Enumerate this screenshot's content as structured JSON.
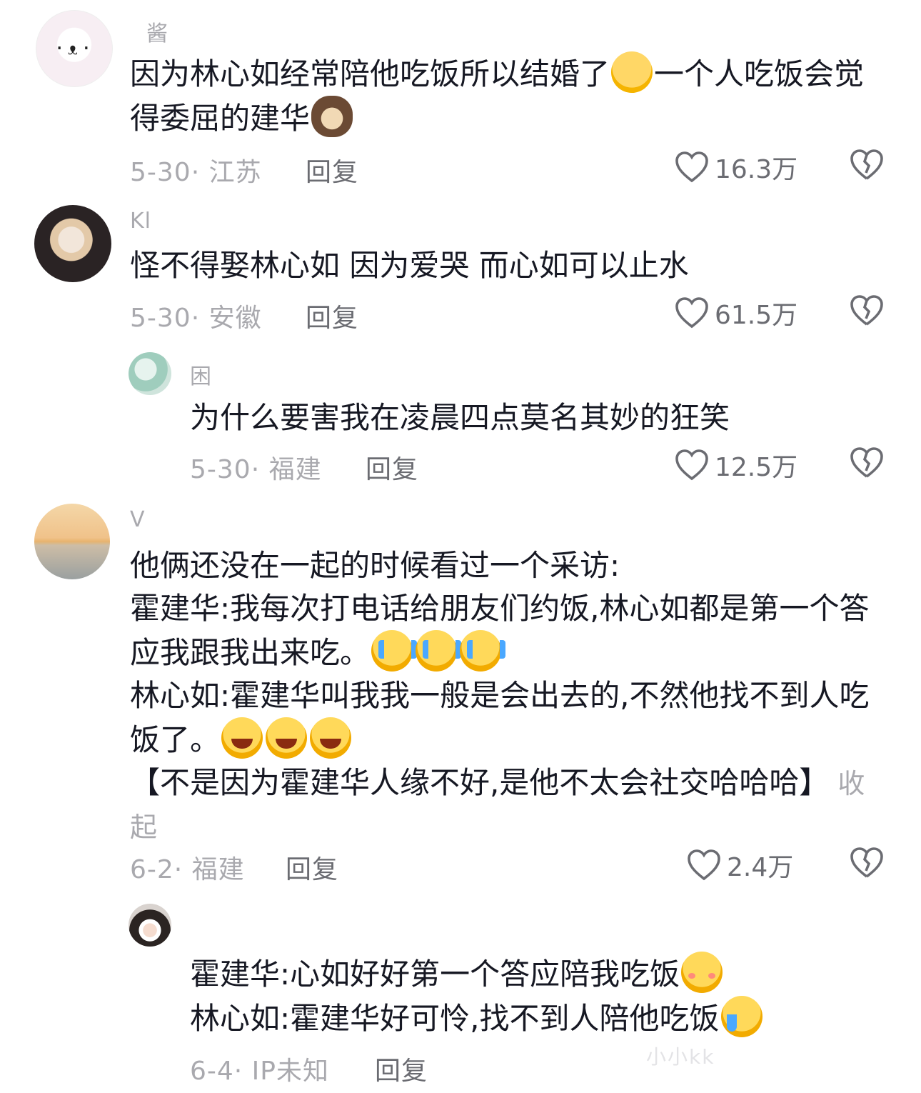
{
  "comments": [
    {
      "username": "酱",
      "text_before": "因为林心如经常陪他吃饭所以结婚了",
      "emoji_1": "pleading-face-emoji",
      "text_mid": "一个人吃饭会觉得委屈的建华",
      "emoji_2": "dog-face-emoji",
      "date_location": "5-30· 江苏",
      "reply_label": "回复",
      "likes": "16.3万"
    },
    {
      "username": "Kl",
      "text": "怪不得娶林心如 因为爱哭 而心如可以止水",
      "date_location": "5-30· 安徽",
      "reply_label": "回复",
      "likes": "61.5万"
    },
    {
      "username": "困",
      "text": "为什么要害我在凌晨四点莫名其妙的狂笑",
      "date_location": "5-30· 福建",
      "reply_label": "回复",
      "likes": "12.5万"
    },
    {
      "username": "V",
      "line1": "他俩还没在一起的时候看过一个采访:",
      "line2": "霍建华:我每次打电话给朋友们约饭,林心如都是第一个答应我跟我出来吃。",
      "line3": "林心如:霍建华叫我我一般是会出去的,不然他找不到人吃饭了。",
      "line4": "【不是因为霍建华人缘不好,是他不太会社交哈哈哈】",
      "collapse_label": "收起",
      "date_location": "6-2· 福建",
      "reply_label": "回复",
      "likes": "2.4万"
    },
    {
      "username": "",
      "line1": "霍建华:心如好好第一个答应陪我吃饭",
      "line2": "林心如:霍建华好可怜,找不到人陪他吃饭",
      "date_location": "6-4· IP未知",
      "reply_label": "回复"
    }
  ],
  "watermark": "小小kk",
  "colors": {
    "meta": "#a9a9ae",
    "text": "#161823",
    "action": "#6b6c72"
  }
}
